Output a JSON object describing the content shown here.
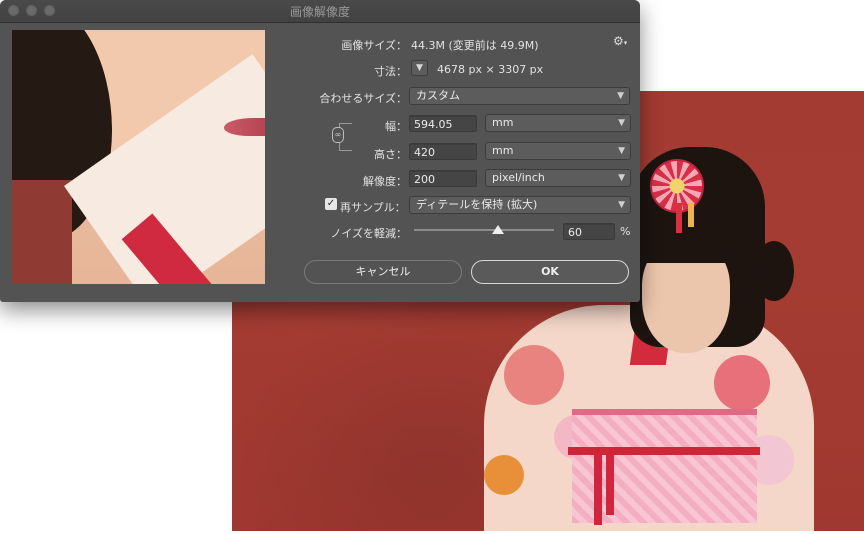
{
  "dialog": {
    "title": "画像解像度"
  },
  "image_size": {
    "label": "画像サイズ：",
    "value": "44.3M (変更前は 49.9M)"
  },
  "dimensions": {
    "label": "寸法：",
    "value": "4678 px × 3307 px"
  },
  "fit_to": {
    "label": "合わせるサイズ：",
    "value": "カスタム"
  },
  "width": {
    "label": "幅：",
    "value": "594.05",
    "unit": "mm"
  },
  "height": {
    "label": "高さ：",
    "value": "420",
    "unit": "mm"
  },
  "resolution": {
    "label": "解像度：",
    "value": "200",
    "unit": "pixel/inch"
  },
  "resample": {
    "label": "再サンプル：",
    "checked": true,
    "method": "ディテールを保持 (拡大)"
  },
  "noise_reduction": {
    "label": "ノイズを軽減：",
    "value": "60",
    "unit": "%",
    "level": 0.6
  },
  "buttons": {
    "cancel": "キャンセル",
    "ok": "OK"
  },
  "icons": {
    "gear": "gear-icon",
    "chevron": "chevron-down-icon",
    "link": "link-icon",
    "check": "checkmark-icon"
  },
  "colors": {
    "dialog_bg": "#535353",
    "photo_wall": "#a43b33"
  }
}
